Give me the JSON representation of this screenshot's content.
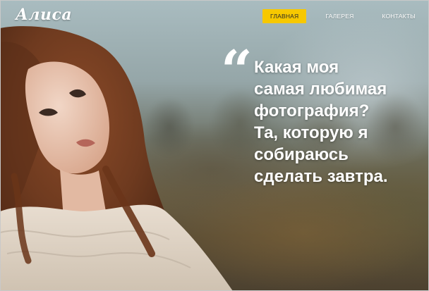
{
  "header": {
    "logo": "Алиса",
    "nav": [
      {
        "label": "ГЛАВНАЯ",
        "active": true
      },
      {
        "label": "ГАЛЕРЕЯ",
        "active": false
      },
      {
        "label": "КОНТАКТЫ",
        "active": false
      }
    ]
  },
  "hero": {
    "quote_mark": "“",
    "quote_lines": [
      "Какая моя",
      "самая любимая",
      "фотография?",
      "Та, которую я",
      "собираюсь",
      "сделать завтра."
    ]
  },
  "colors": {
    "accent": "#f7c800",
    "text": "#ffffff"
  },
  "icons": {
    "quote": "quote-icon"
  }
}
